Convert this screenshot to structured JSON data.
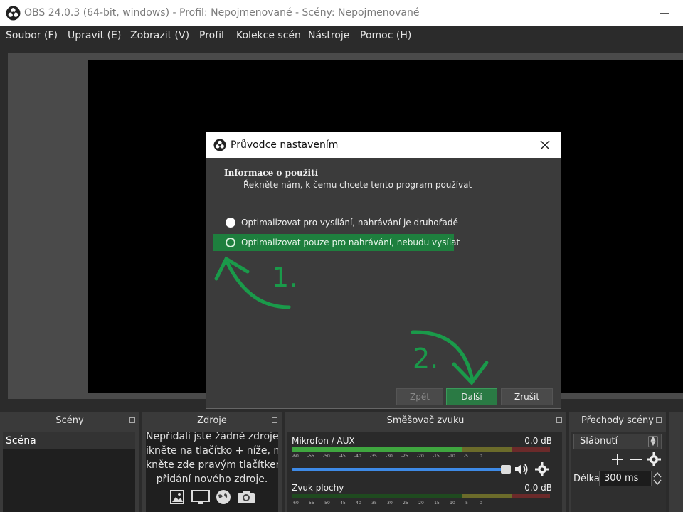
{
  "window": {
    "title": "OBS 24.0.3 (64-bit, windows) - Profil: Nepojmenované - Scény: Nepojmenované"
  },
  "menu": [
    "Soubor (F)",
    "Upravit (E)",
    "Zobrazit (V)",
    "Profil",
    "Kolekce scén",
    "Nástroje",
    "Pomoc (H)"
  ],
  "docks": {
    "scenes": {
      "title": "Scény",
      "items": [
        "Scéna"
      ]
    },
    "sources": {
      "title": "Zdroje",
      "empty_lines": [
        "Nepřidali jste žádné zdroje.",
        "ikněte na tlačítko + níže, neb",
        "kněte zde pravým tlačítkem, p",
        "přidání nového zdroje."
      ]
    },
    "mixer": {
      "title": "Směšovač zvuku",
      "tracks": [
        {
          "name": "Mikrofon / AUX",
          "db": "0.0 dB"
        },
        {
          "name": "Zvuk plochy",
          "db": "0.0 dB"
        }
      ],
      "scale": [
        "-60",
        "-55",
        "-50",
        "-45",
        "-40",
        "-35",
        "-30",
        "-25",
        "-20",
        "-15",
        "-10",
        "-5",
        "0"
      ]
    },
    "transitions": {
      "title": "Přechody scény",
      "selected": "Slábnutí",
      "duration_label": "Délka",
      "duration_value": "300 ms"
    }
  },
  "dialog": {
    "title": "Průvodce nastavením",
    "heading": "Informace o použití",
    "subheading": "Řekněte nám, k čemu chcete tento program používat",
    "options": [
      "Optimalizovat pro vysílání, nahrávání je druhořadé",
      "Optimalizovat pouze pro nahrávání, nebudu vysílat"
    ],
    "buttons": {
      "back": "Zpět",
      "next": "Další",
      "cancel": "Zrušit"
    }
  },
  "annotations": {
    "step1": "1.",
    "step2": "2.",
    "color": "#1a9a4a"
  }
}
